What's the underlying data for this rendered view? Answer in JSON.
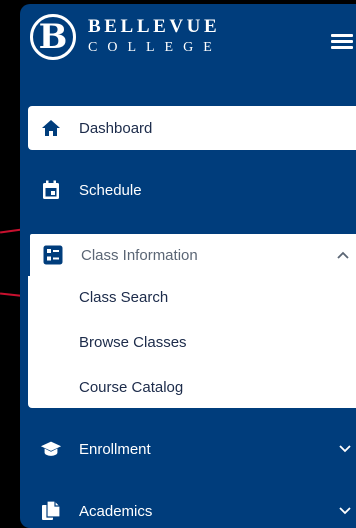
{
  "brand": {
    "mark": "B",
    "line1": "BELLEVUE",
    "line2": "COLLEGE"
  },
  "header": {
    "menu_icon": "hamburger-menu-icon"
  },
  "nav": {
    "items": [
      {
        "label": "Dashboard",
        "icon": "home-icon",
        "state": "active"
      },
      {
        "label": "Schedule",
        "icon": "calendar-icon",
        "state": "normal"
      },
      {
        "label": "Class Information",
        "icon": "list-icon",
        "state": "expanded",
        "children": [
          {
            "label": "Class Search"
          },
          {
            "label": "Browse Classes"
          },
          {
            "label": "Course Catalog"
          }
        ]
      },
      {
        "label": "Enrollment",
        "icon": "graduation-cap-icon",
        "state": "collapsed"
      },
      {
        "label": "Academics",
        "icon": "documents-icon",
        "state": "collapsed"
      }
    ]
  },
  "colors": {
    "sidebar_bg": "#003d7c",
    "active_bg": "#ffffff",
    "annotation_line": "#c8102e"
  }
}
